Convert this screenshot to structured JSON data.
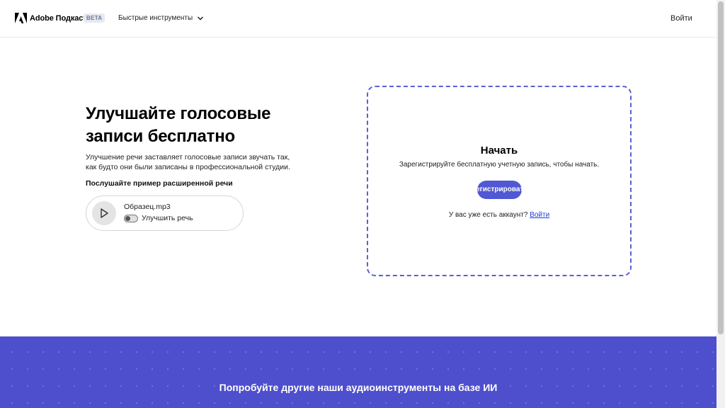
{
  "header": {
    "brand": "Adobe Подкаст",
    "badge": "BETA",
    "tools_menu": "Быстрые инструменты",
    "sign_in": "Войти"
  },
  "hero": {
    "title": "Улучшайте голосовые записи бесплатно",
    "description": "Улучшение речи заставляет голосовые записи звучать так, как будто они были записаны в профессиональной студии.",
    "sample_label": "Послушайте пример расширенной речи",
    "player": {
      "file_name": "Образец.mp3",
      "toggle_label": "Улучшить речь",
      "toggle_on": false
    }
  },
  "card": {
    "title": "Начать",
    "subtitle": "Зарегистрируйте бесплатную учетную запись, чтобы начать.",
    "signup_button": "Зарегистрироваться",
    "have_account": "У вас уже есть аккаунт?",
    "sign_in_link": "Войти"
  },
  "band": {
    "text": "Попробуйте другие наши аудиоинструменты на базе ИИ"
  },
  "colors": {
    "accent": "#5058d4",
    "band": "#4d4fcc",
    "link": "#1b3fd6"
  }
}
